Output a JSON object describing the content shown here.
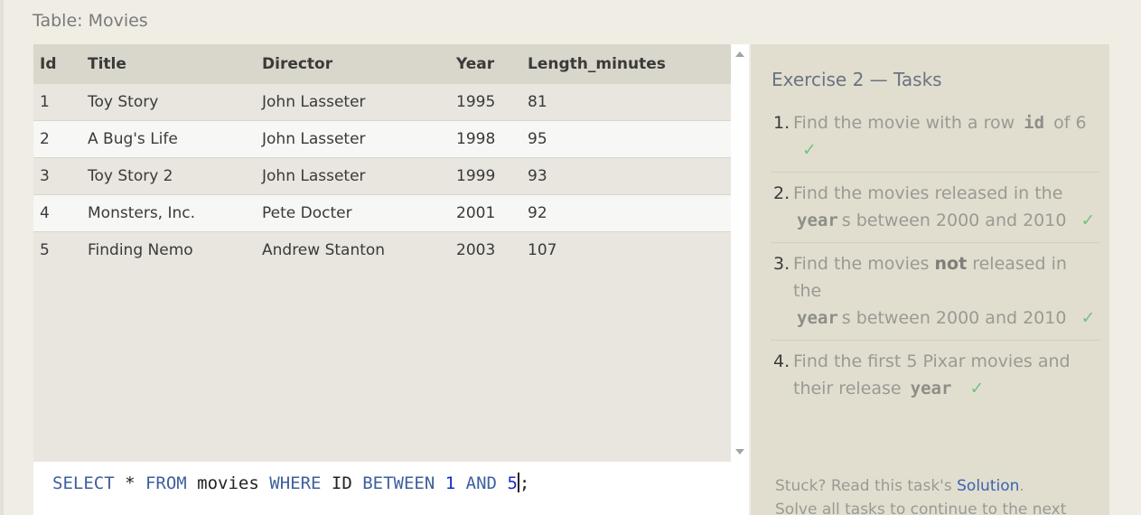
{
  "table": {
    "heading": "Table: Movies",
    "columns": [
      "Id",
      "Title",
      "Director",
      "Year",
      "Length_minutes"
    ],
    "rows": [
      [
        "1",
        "Toy Story",
        "John Lasseter",
        "1995",
        "81"
      ],
      [
        "2",
        "A Bug's Life",
        "John Lasseter",
        "1998",
        "95"
      ],
      [
        "3",
        "Toy Story 2",
        "John Lasseter",
        "1999",
        "93"
      ],
      [
        "4",
        "Monsters, Inc.",
        "Pete Docter",
        "2001",
        "92"
      ],
      [
        "5",
        "Finding Nemo",
        "Andrew Stanton",
        "2003",
        "107"
      ]
    ]
  },
  "editor": {
    "kw_select": "SELECT",
    "star": " * ",
    "kw_from": "FROM",
    "table_name": " movies ",
    "kw_where": "WHERE",
    "col": " ID ",
    "kw_between": "BETWEEN",
    "num1": "1",
    "kw_and": "AND",
    "num2": "5",
    "end": ";"
  },
  "tasks": {
    "title": "Exercise 2 — Tasks",
    "items": [
      {
        "num": "1.",
        "before": "Find the movie with a row",
        "code": "id",
        "after": "of 6",
        "check": "✓"
      },
      {
        "num": "2.",
        "before": "Find the movies released in the",
        "code": "year",
        "after": "s between 2000 and 2010",
        "check": "✓"
      },
      {
        "num": "3.",
        "before": "Find the movies",
        "strong": "not",
        "mid": "released in the",
        "code": "year",
        "after": "s between 2000 and 2010",
        "check": "✓"
      },
      {
        "num": "4.",
        "before": "Find the first 5 Pixar movies and their release",
        "code": "year",
        "check": "✓"
      }
    ],
    "footer_prefix": "Stuck? Read this task's",
    "footer_link": "Solution",
    "footer_period": ".",
    "footer_line2": "Solve all tasks to continue to the next"
  },
  "colors": {
    "accent_link": "#3b63b0",
    "check": "#74c27f",
    "sql_keyword": "#3d5f9e",
    "sql_number": "#1a28c8"
  }
}
